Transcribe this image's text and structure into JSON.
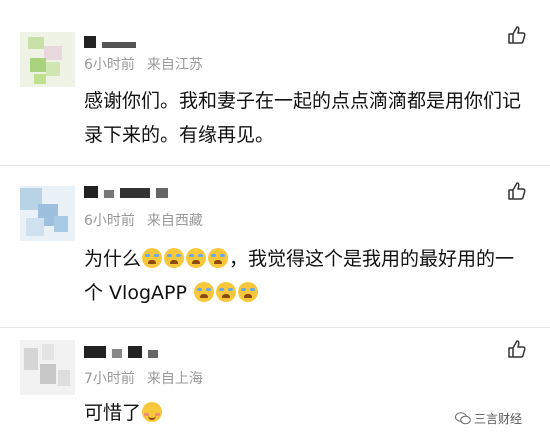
{
  "comments": [
    {
      "time": "6小时前",
      "location": "来自江苏",
      "text": "感谢你们。我和妻子在一起的点点滴滴都是用你们记录下来的。有缘再见。"
    },
    {
      "time": "6小时前",
      "location": "来自西藏",
      "text_before": "为什么",
      "text_after": "，我觉得这个是我用的最好用的一个 VlogAPP"
    },
    {
      "time": "7小时前",
      "location": "来自上海",
      "text": "可惜了"
    }
  ],
  "icons": {
    "like": "thumbs-up-icon",
    "crying": "loudly-crying-emoji",
    "blush": "blushing-emoji",
    "watermark": "wechat-icon"
  },
  "watermark": {
    "label": "三言财经"
  },
  "colors": {
    "text": "#111111",
    "meta": "#9a9a9a",
    "emoji": "#f8c83c",
    "divider": "#e6e6e6"
  }
}
